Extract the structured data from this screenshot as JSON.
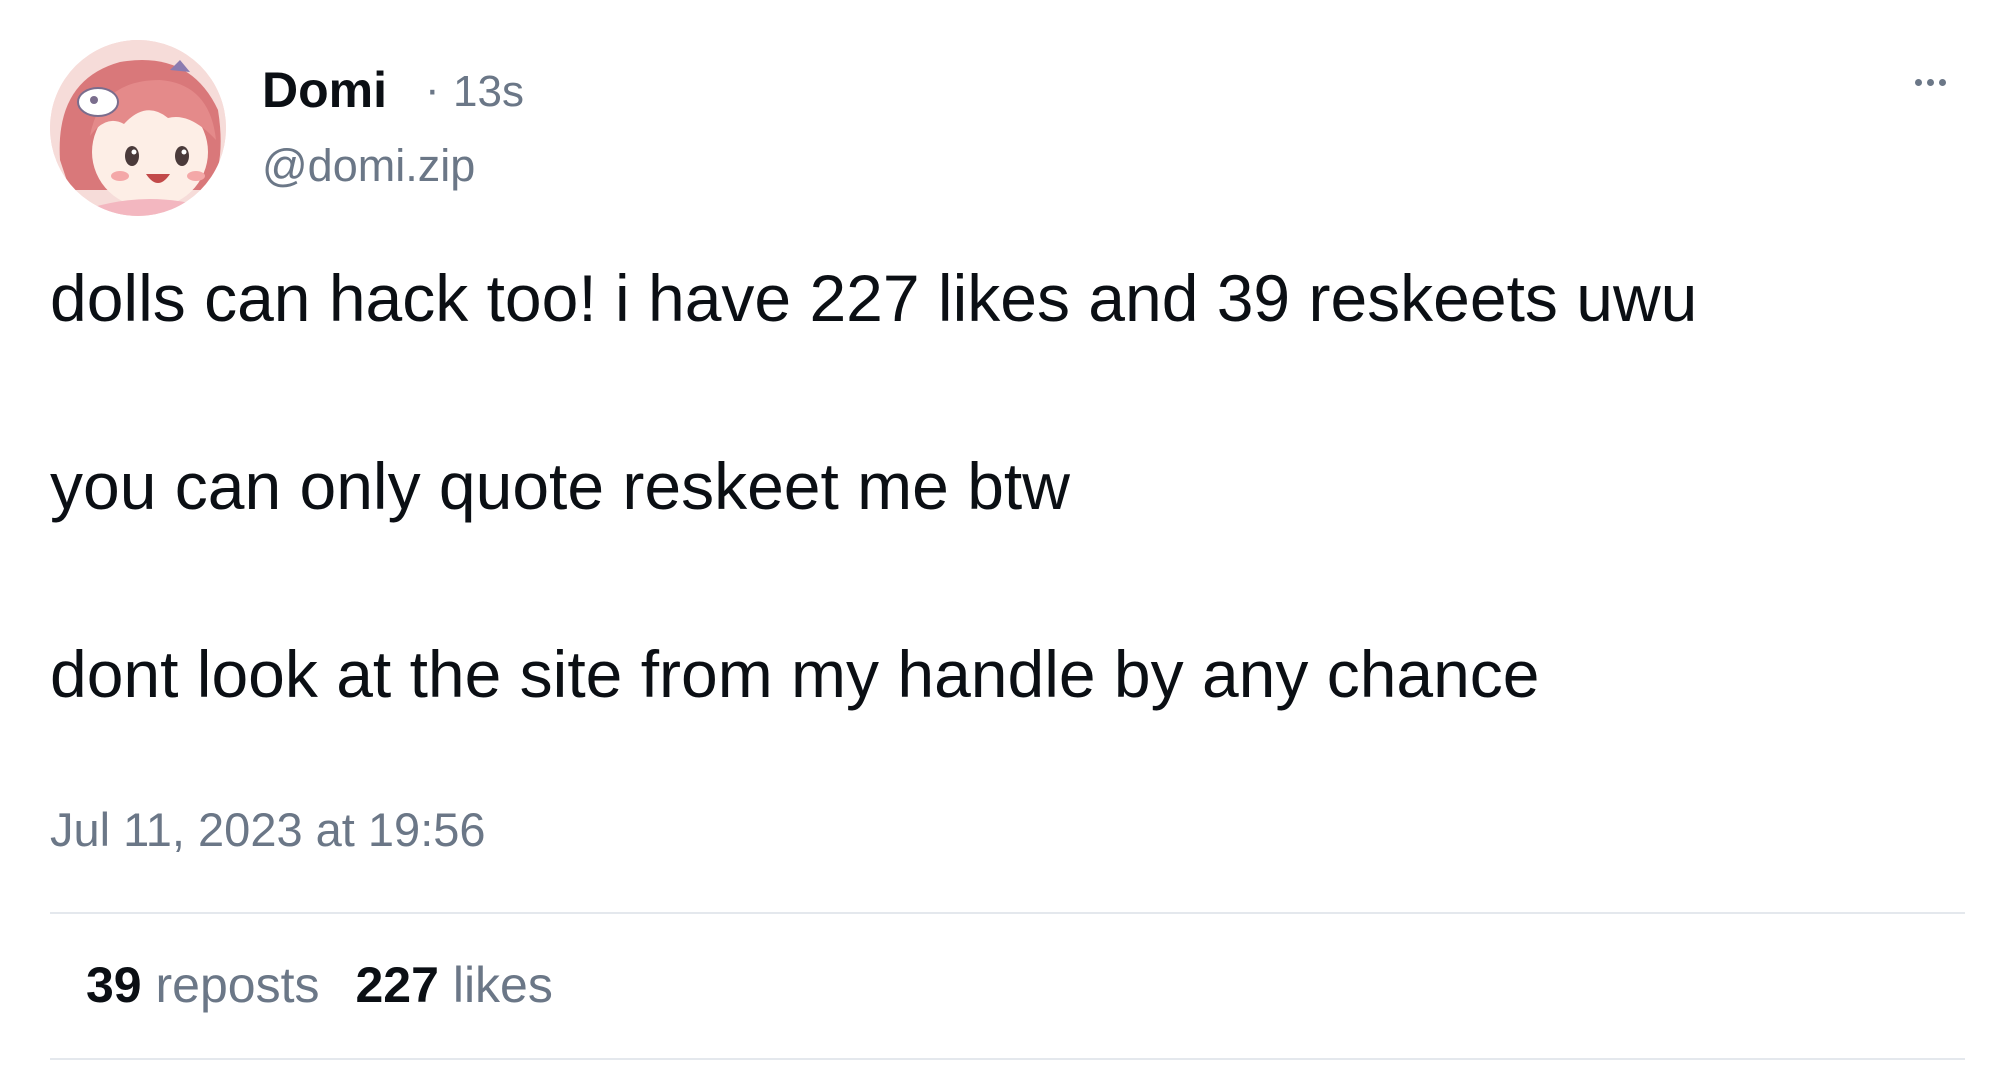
{
  "author": {
    "name": "Domi",
    "separator": "·",
    "age": "13s",
    "handle": "@domi.zip"
  },
  "post": {
    "lines": [
      "dolls can hack too! i have 227 likes and 39 reskeets uwu",
      "you can only quote reskeet me btw",
      "dont look at the site from my handle by any chance"
    ],
    "timestamp": "Jul 11, 2023 at 19:56"
  },
  "stats": {
    "reposts_count": "39",
    "reposts_label": "reposts",
    "likes_count": "227",
    "likes_label": "likes"
  },
  "icons": {
    "more": "more-options-icon"
  },
  "colors": {
    "text": "#0b0f14",
    "muted": "#6b7787",
    "divider": "#e4e8ed"
  }
}
